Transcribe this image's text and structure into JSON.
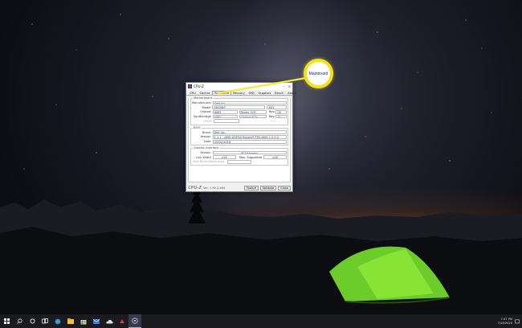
{
  "window": {
    "title": "CPU-Z",
    "minimize": "–",
    "close": "×",
    "tabs": [
      "CPU",
      "Caches",
      "Mainboard",
      "Memory",
      "SPD",
      "Graphics",
      "Bench",
      "About"
    ],
    "active_tab": "Mainboard",
    "motherboard": {
      "legend": "Motherboard",
      "manufacturer_label": "Manufacturer",
      "manufacturer_value": "Dell Inc.",
      "model_label": "Model",
      "model_value": "0H0V6P",
      "model_rev": "X01",
      "chipset_label": "Chipset",
      "chipset_vendor": "AMD",
      "chipset_name": "Ryzen SOC",
      "chipset_rev_label": "Rev.",
      "chipset_rev": "00",
      "southbridge_label": "Southbridge",
      "southbridge_vendor": "AMD",
      "southbridge_name": "Carrizo FCH",
      "southbridge_rev_label": "Rev.",
      "southbridge_rev": "51",
      "lpcio_label": "LPCIO"
    },
    "bios": {
      "legend": "BIOS",
      "brand_label": "Brand",
      "brand_value": "Dell Inc.",
      "version_label": "Version",
      "version_value": "1.1.1 - AMD AGESA RavenPI FP5-AM4 1.0.0.3",
      "date_label": "Date",
      "date_value": "05/02/2018"
    },
    "graphic_interface": {
      "legend": "Graphic Interface",
      "version_label": "Version",
      "version_value": "PCI-Express",
      "link_width_label": "Link Width",
      "link_width_value": "x16",
      "max_supported_label": "Max. Supported",
      "max_supported_value": "x16",
      "side_band_label": "Side Band Addressing"
    },
    "status": {
      "brand": "CPU-Z",
      "version": "Ver. 1.92.2.x64",
      "tools_label": "Tools",
      "validate_label": "Validate",
      "close_label": "Close"
    }
  },
  "callout": {
    "label": "Mainboard",
    "color": "#f5e11a"
  },
  "taskbar": {
    "icons": [
      "windows-icon",
      "search-icon",
      "cortana-icon",
      "task-view-icon",
      "edge-icon",
      "file-explorer-icon",
      "store-icon",
      "mail-icon",
      "onedrive-icon",
      "app-icon",
      "cpuz-icon"
    ],
    "time": "7:47 PM",
    "date": "7/16/2020"
  }
}
